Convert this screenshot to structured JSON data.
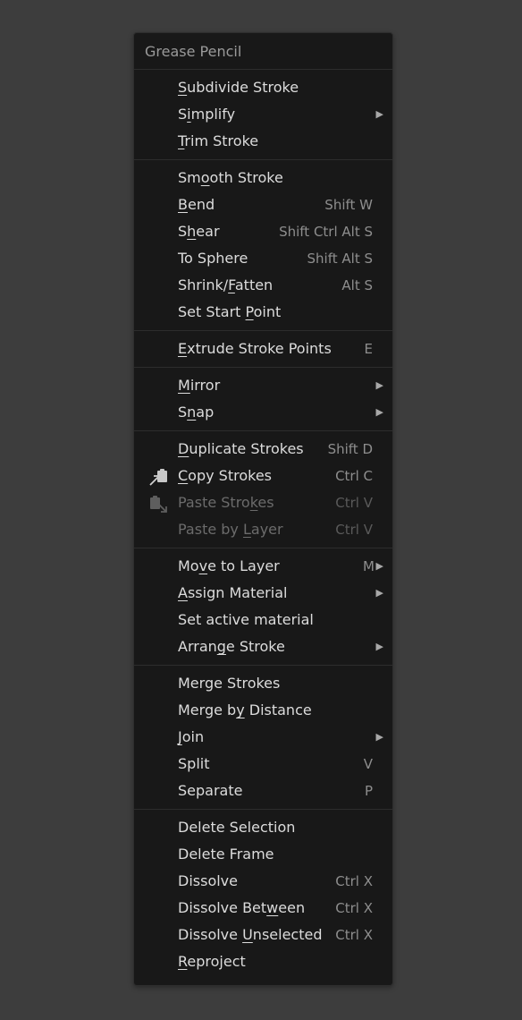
{
  "menu": {
    "title": "Grease Pencil",
    "sections": [
      [
        {
          "pre": "",
          "ul": "S",
          "post": "ubdivide Stroke",
          "shortcut": "",
          "submenu": false,
          "disabled": false,
          "icon": ""
        },
        {
          "pre": "S",
          "ul": "i",
          "post": "mplify",
          "shortcut": "",
          "submenu": true,
          "disabled": false,
          "icon": ""
        },
        {
          "pre": "",
          "ul": "T",
          "post": "rim Stroke",
          "shortcut": "",
          "submenu": false,
          "disabled": false,
          "icon": ""
        }
      ],
      [
        {
          "pre": "Sm",
          "ul": "o",
          "post": "oth Stroke",
          "shortcut": "",
          "submenu": false,
          "disabled": false,
          "icon": ""
        },
        {
          "pre": "",
          "ul": "B",
          "post": "end",
          "shortcut": "Shift W",
          "submenu": false,
          "disabled": false,
          "icon": ""
        },
        {
          "pre": "S",
          "ul": "h",
          "post": "ear",
          "shortcut": "Shift Ctrl Alt S",
          "submenu": false,
          "disabled": false,
          "icon": ""
        },
        {
          "pre": "To Sphere",
          "ul": "",
          "post": "",
          "shortcut": "Shift Alt S",
          "submenu": false,
          "disabled": false,
          "icon": ""
        },
        {
          "pre": "Shrink/",
          "ul": "F",
          "post": "atten",
          "shortcut": "Alt S",
          "submenu": false,
          "disabled": false,
          "icon": ""
        },
        {
          "pre": "Set Start ",
          "ul": "P",
          "post": "oint",
          "shortcut": "",
          "submenu": false,
          "disabled": false,
          "icon": ""
        }
      ],
      [
        {
          "pre": "",
          "ul": "E",
          "post": "xtrude Stroke Points",
          "shortcut": "E",
          "submenu": false,
          "disabled": false,
          "icon": ""
        }
      ],
      [
        {
          "pre": "",
          "ul": "M",
          "post": "irror",
          "shortcut": "",
          "submenu": true,
          "disabled": false,
          "icon": ""
        },
        {
          "pre": "S",
          "ul": "n",
          "post": "ap",
          "shortcut": "",
          "submenu": true,
          "disabled": false,
          "icon": ""
        }
      ],
      [
        {
          "pre": "",
          "ul": "D",
          "post": "uplicate Strokes",
          "shortcut": "Shift D",
          "submenu": false,
          "disabled": false,
          "icon": ""
        },
        {
          "pre": "",
          "ul": "C",
          "post": "opy Strokes",
          "shortcut": "Ctrl C",
          "submenu": false,
          "disabled": false,
          "icon": "copy-icon"
        },
        {
          "pre": "Paste Stro",
          "ul": "k",
          "post": "es",
          "shortcut": "Ctrl V",
          "submenu": false,
          "disabled": true,
          "icon": "paste-icon"
        },
        {
          "pre": "Paste by ",
          "ul": "L",
          "post": "ayer",
          "shortcut": "Ctrl V",
          "submenu": false,
          "disabled": true,
          "icon": ""
        }
      ],
      [
        {
          "pre": "Mo",
          "ul": "v",
          "post": "e to Layer",
          "shortcut": "M",
          "submenu": true,
          "disabled": false,
          "icon": ""
        },
        {
          "pre": "",
          "ul": "A",
          "post": "ssign Material",
          "shortcut": "",
          "submenu": true,
          "disabled": false,
          "icon": ""
        },
        {
          "pre": "Set active material",
          "ul": "",
          "post": "",
          "shortcut": "",
          "submenu": false,
          "disabled": false,
          "icon": ""
        },
        {
          "pre": "Arran",
          "ul": "g",
          "post": "e Stroke",
          "shortcut": "",
          "submenu": true,
          "disabled": false,
          "icon": ""
        }
      ],
      [
        {
          "pre": "Merge Strokes",
          "ul": "",
          "post": "",
          "shortcut": "",
          "submenu": false,
          "disabled": false,
          "icon": ""
        },
        {
          "pre": "Merge b",
          "ul": "y",
          "post": " Distance",
          "shortcut": "",
          "submenu": false,
          "disabled": false,
          "icon": ""
        },
        {
          "pre": "",
          "ul": "J",
          "post": "oin",
          "shortcut": "",
          "submenu": true,
          "disabled": false,
          "icon": ""
        },
        {
          "pre": "Split",
          "ul": "",
          "post": "",
          "shortcut": "V",
          "submenu": false,
          "disabled": false,
          "icon": ""
        },
        {
          "pre": "Separate",
          "ul": "",
          "post": "",
          "shortcut": "P",
          "submenu": false,
          "disabled": false,
          "icon": ""
        }
      ],
      [
        {
          "pre": "Delete Selection",
          "ul": "",
          "post": "",
          "shortcut": "",
          "submenu": false,
          "disabled": false,
          "icon": ""
        },
        {
          "pre": "Delete Frame",
          "ul": "",
          "post": "",
          "shortcut": "",
          "submenu": false,
          "disabled": false,
          "icon": ""
        },
        {
          "pre": "Dissolve",
          "ul": "",
          "post": "",
          "shortcut": "Ctrl X",
          "submenu": false,
          "disabled": false,
          "icon": ""
        },
        {
          "pre": "Dissolve Bet",
          "ul": "w",
          "post": "een",
          "shortcut": "Ctrl X",
          "submenu": false,
          "disabled": false,
          "icon": ""
        },
        {
          "pre": "Dissolve ",
          "ul": "U",
          "post": "nselected",
          "shortcut": "Ctrl X",
          "submenu": false,
          "disabled": false,
          "icon": ""
        },
        {
          "pre": "",
          "ul": "R",
          "post": "eproject",
          "shortcut": "",
          "submenu": false,
          "disabled": false,
          "icon": ""
        }
      ]
    ]
  },
  "glyphs": {
    "submenu_arrow": "▶"
  },
  "colors": {
    "background": "#3d3d3d",
    "menu_bg": "#181818",
    "text": "#dcdcdc",
    "text_disabled": "#6b6b6b",
    "shortcut": "#8e8e8e",
    "title": "#9a9a9a"
  }
}
